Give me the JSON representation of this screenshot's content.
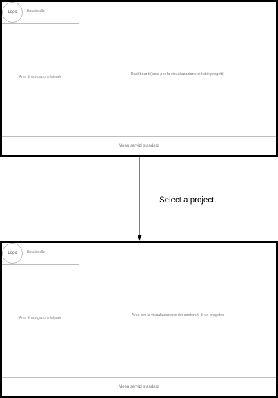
{
  "screens": [
    {
      "logo": "Logo",
      "app_name": "Emotionally",
      "nav_label": "Area di navigazione laterale",
      "main_label": "Dashboard (area per la visualizzazione di tutti i progetti)",
      "footer": "Menù servizi standard"
    },
    {
      "logo": "Logo",
      "app_name": "Emotionally",
      "nav_label": "Area di navigazione laterale",
      "main_label": "Area per la visualizzazione dei contenuti di un progetto",
      "footer": "Menù servizi standard"
    }
  ],
  "transition": {
    "label": "Select a project"
  }
}
